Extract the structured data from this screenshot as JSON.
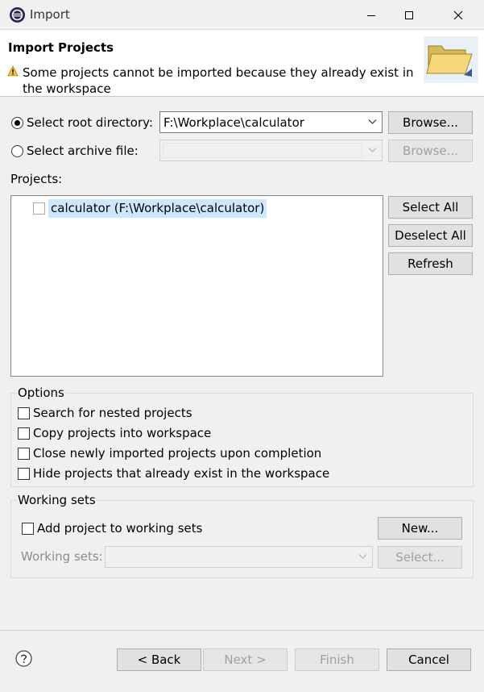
{
  "window": {
    "title": "Import"
  },
  "header": {
    "title": "Import Projects",
    "message": "Some projects cannot be imported because they already exist in the workspace"
  },
  "source": {
    "root_dir_label": "Select root directory:",
    "root_dir_value": "F:\\Workplace\\calculator",
    "archive_label": "Select archive file:",
    "browse_label": "Browse...",
    "browse_archive_label": "Browse..."
  },
  "projects": {
    "label": "Projects:",
    "items": [
      {
        "label": "calculator (F:\\Workplace\\calculator)",
        "checked": false
      }
    ],
    "select_all": "Select All",
    "deselect_all": "Deselect All",
    "refresh": "Refresh"
  },
  "options": {
    "title": "Options",
    "items": [
      "Search for nested projects",
      "Copy projects into workspace",
      "Close newly imported projects upon completion",
      "Hide projects that already exist in the workspace"
    ]
  },
  "working_sets": {
    "title": "Working sets",
    "add_label": "Add project to working sets",
    "new_label": "New...",
    "sets_label": "Working sets:",
    "select_label": "Select..."
  },
  "footer": {
    "back": "< Back",
    "next": "Next >",
    "finish": "Finish",
    "cancel": "Cancel"
  },
  "colors": {
    "selection": "#cce8ff",
    "window_bg": "#f0f0f0",
    "warning": "#f2c037"
  },
  "icons": [
    "eclipse-app-icon",
    "warning-icon",
    "folder-graphic",
    "chevron-down-icon",
    "help-icon"
  ]
}
